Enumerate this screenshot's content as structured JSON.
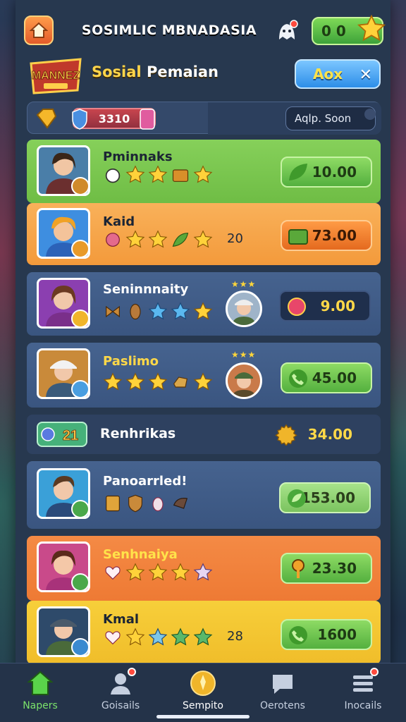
{
  "header": {
    "title": "SOSIMLIC MBNADASIA",
    "coins": "0 0",
    "page_title_1": "Sosial",
    "page_title_2": "Pemaian",
    "add_button": "Aox",
    "logo_text": "MANNEZ"
  },
  "filter": {
    "score": "3310",
    "search_value": "Aqlp. Soon"
  },
  "rows": [
    {
      "name": "Pminnaks",
      "rank": "",
      "price": "10.00"
    },
    {
      "name": "Kaid",
      "rank": "20",
      "price": "73.00"
    },
    {
      "name": "Seninnnaity",
      "rank": "",
      "price": "9.00"
    },
    {
      "name": "Paslimo",
      "rank": "",
      "price": "45.00"
    },
    {
      "name": "Panoarrled!",
      "rank": "",
      "price": "153.00"
    },
    {
      "name": "Senhnaiya",
      "rank": "",
      "price": "23.30"
    },
    {
      "name": "Kmal",
      "rank": "28",
      "price": "1600"
    }
  ],
  "section": {
    "label": "Renhrikas",
    "value": "34.00",
    "badge": "21"
  },
  "nav": [
    {
      "label": "Napers"
    },
    {
      "label": "Goisails"
    },
    {
      "label": "Sempito"
    },
    {
      "label": "Oerotens"
    },
    {
      "label": "Inocails"
    }
  ],
  "colors": {
    "green_row": "#7cc74a",
    "orange_row": "#f7a84a",
    "blue_row": "#3e5b86",
    "yellow_row": "#f2c233",
    "accent_gold": "#ffd848"
  }
}
